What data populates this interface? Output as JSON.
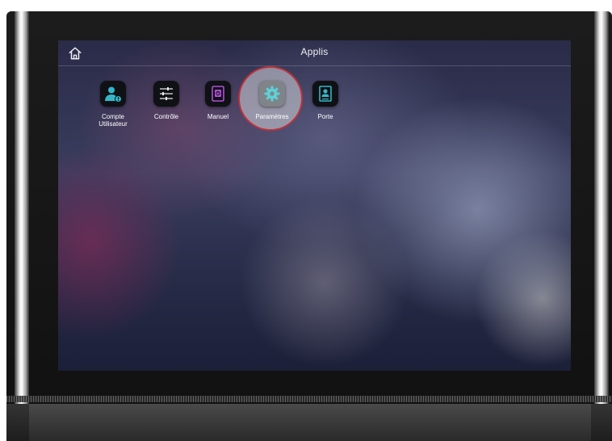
{
  "screen": {
    "title": "Applis"
  },
  "apps": [
    {
      "label": "Compte\nUtilisateur",
      "icon": "user-account-icon",
      "accent": "#35b6c8"
    },
    {
      "label": "Contrôle",
      "icon": "sliders-icon",
      "accent": "#ffffff"
    },
    {
      "label": "Manuel",
      "icon": "manual-book-icon",
      "accent": "#b04fd8"
    },
    {
      "label": "Paramètres",
      "icon": "gear-icon",
      "accent": "#5fd0d8",
      "highlighted": true
    },
    {
      "label": "Porte",
      "icon": "door-icon",
      "accent": "#35b6c8"
    }
  ],
  "colors": {
    "highlight_ring": "#c0303a",
    "tile_background": "#0f1115"
  }
}
